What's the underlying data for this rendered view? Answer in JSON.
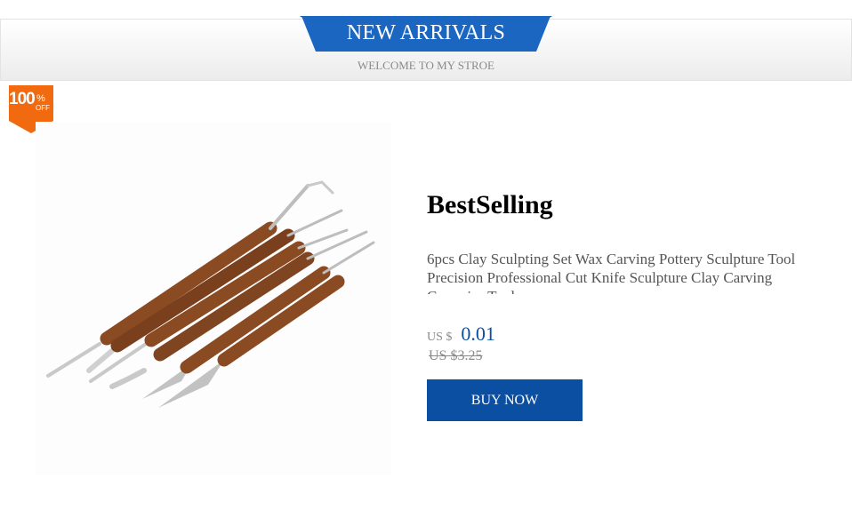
{
  "header": {
    "title": "NEW ARRIVALS",
    "subtitle": "WELCOME TO MY STROE"
  },
  "badge": {
    "number": "100",
    "percent": "%",
    "off": "OFF",
    "color": "#f26a10"
  },
  "product": {
    "image_icon": "clay-sculpting-tools-image",
    "label": "BestSelling",
    "description": "6pcs Clay Sculpting Set Wax Carving Pottery Sculpture Tool Precision Professional Cut Knife Sculpture Clay Carving Ceramics Tools",
    "currency": "US $",
    "price": "0.01",
    "old_price": "US $3.25",
    "buy_label": "BUY NOW"
  },
  "colors": {
    "accent": "#0b4fa3",
    "ribbon": "#1a66c0",
    "ribbon_dark": "#0c3f85"
  }
}
